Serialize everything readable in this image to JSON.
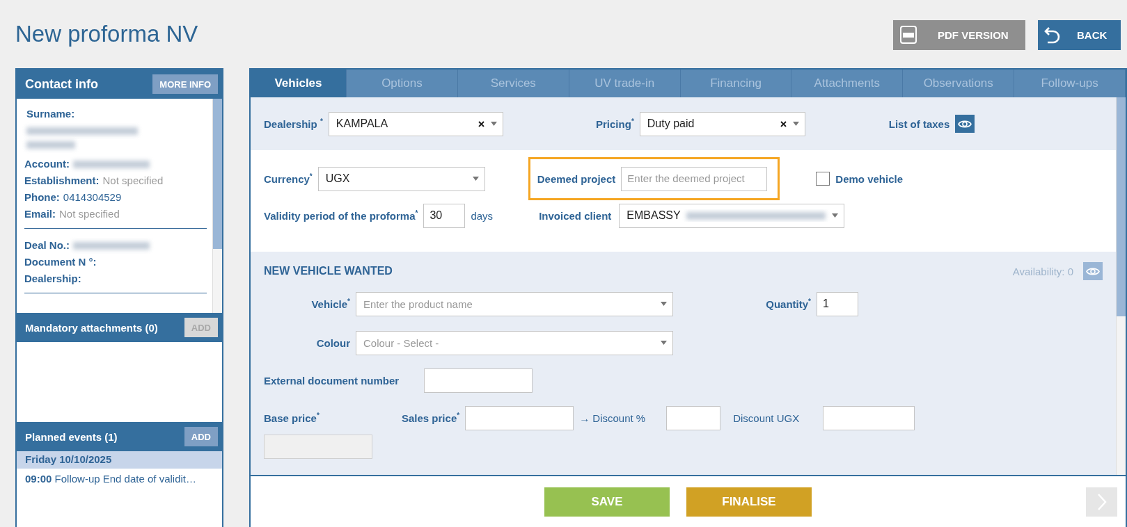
{
  "page_title": "New proforma NV",
  "header_buttons": [
    {
      "label": "PDF VERSION",
      "kind": "pdf"
    },
    {
      "label": "BACK",
      "kind": "back"
    }
  ],
  "contact_info": {
    "title": "Contact info",
    "button": "MORE INFO",
    "groups": [
      [
        {
          "label": "Surname:",
          "kind": "stacked",
          "redacted": true
        },
        {
          "label": "Account:",
          "kind": "inline",
          "redacted": true
        },
        {
          "label": "Establishment:",
          "kind": "inline",
          "value": "Not specified",
          "muted": true
        },
        {
          "label": "Phone:",
          "kind": "inline",
          "value": "0414304529",
          "muted": false
        },
        {
          "label": "Email:",
          "kind": "inline",
          "value": "Not specified",
          "muted": true
        }
      ],
      [
        {
          "label": "Deal No.:",
          "kind": "inline",
          "redacted": true
        },
        {
          "label": "Document N °:",
          "kind": "inline"
        },
        {
          "label": "Dealership:",
          "kind": "inline"
        }
      ]
    ]
  },
  "mandatory_attachments": {
    "title": "Mandatory attachments (0)",
    "button": "ADD",
    "disabled": true
  },
  "planned_events": {
    "title": "Planned events (1)",
    "button": "ADD",
    "disabled": false,
    "days": [
      {
        "date": "Friday 10/10/2025",
        "events": [
          {
            "time": "09:00",
            "text": "Follow-up End date of validit…"
          }
        ]
      }
    ]
  },
  "tabs": [
    {
      "label": "Vehicles",
      "selected": true
    },
    {
      "label": "Options",
      "selected": false
    },
    {
      "label": "Services",
      "selected": false
    },
    {
      "label": "UV trade-in",
      "selected": false
    },
    {
      "label": "Financing",
      "selected": false
    },
    {
      "label": "Attachments",
      "selected": false
    },
    {
      "label": "Observations",
      "selected": false
    },
    {
      "label": "Follow-ups",
      "selected": false
    }
  ],
  "form": {
    "dealership": {
      "label": "Dealership $^{*}$",
      "value": "KAMPALA"
    },
    "pricing": {
      "label": "Pricing$^{*}$",
      "value": "Duty paid"
    },
    "list_of_taxes": {
      "label": "List of taxes"
    },
    "currency": {
      "label": "Currency$^{*}$",
      "value": "UGX"
    },
    "deemed_project": {
      "label": "Deemed project",
      "placeholder": "Enter the deemed project",
      "highlighted": true
    },
    "demo_vehicle": {
      "label": "Demo vehicle",
      "checked": false
    },
    "validity": {
      "label": "Validity period of the proforma$^{*}$",
      "value": "30",
      "unit": "days"
    },
    "invoiced_client": {
      "label": "Invoiced client",
      "value": "EMBASSY",
      "redacted_suffix": true
    }
  },
  "vehicle_section": {
    "title": "NEW VEHICLE WANTED",
    "availability": "Availability: 0",
    "vehicle": {
      "label": "Vehicle$^{*}$",
      "placeholder": "Enter the product name"
    },
    "quantity": {
      "label": "Quantity$^{*}$",
      "value": "1"
    },
    "colour": {
      "label": "Colour",
      "placeholder": "Colour - Select -"
    },
    "external_document": {
      "label": "External document number"
    },
    "base_price": {
      "label": "Base price$^{*}$",
      "disabled": true
    },
    "sales_price": {
      "label": "Sales price$^{*}$"
    },
    "discount_percent": {
      "label": "→ Discount %"
    },
    "discount_amount": {
      "label": "Discount UGX"
    }
  },
  "footer": {
    "buttons": [
      {
        "label": "SAVE",
        "kind": "save"
      },
      {
        "label": "FINALISE",
        "kind": "finalise"
      }
    ],
    "next_disabled": true
  }
}
